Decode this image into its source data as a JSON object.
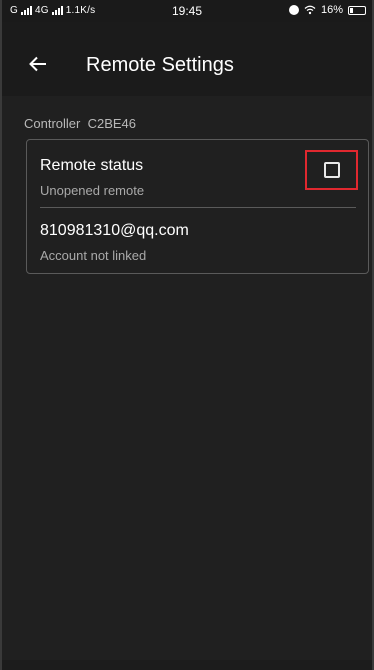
{
  "status_bar": {
    "network": "G",
    "network2": "4G",
    "speed": "1.1K/s",
    "time": "19:45",
    "battery": "16%",
    "icons": [
      "signal-icon",
      "alarm-icon",
      "wifi-icon",
      "battery-icon"
    ]
  },
  "app_bar": {
    "back_icon": "arrow-left-icon",
    "title": "Remote Settings"
  },
  "controller": {
    "label": "Controller  C2BE46"
  },
  "card": {
    "remote_status": {
      "title": "Remote status",
      "subtitle": "Unopened remote",
      "checked": false
    },
    "account": {
      "email": "810981310@qq.com",
      "subtitle": "Account not linked"
    }
  },
  "colors": {
    "background": "#202020",
    "card_border": "#5a5a5a",
    "highlight": "#e0282f",
    "secondary_text": "#a9a9a9"
  }
}
